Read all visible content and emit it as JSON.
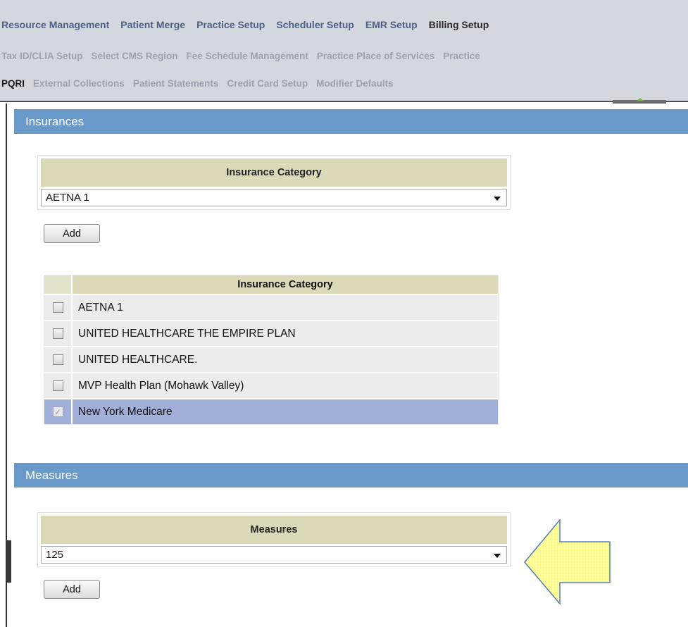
{
  "nav": {
    "main": [
      "Resource Management",
      "Patient Merge",
      "Practice Setup",
      "Scheduler Setup",
      "EMR Setup",
      "Billing Setup"
    ],
    "active_main": "Billing Setup",
    "sub_row1": [
      "Tax ID/CLIA Setup",
      "Select CMS Region",
      "Fee Schedule Management",
      "Practice Place of Services",
      "Practice"
    ],
    "sub_row2": [
      "PQRI",
      "External Collections",
      "Patient Statements",
      "Credit Card Setup",
      "Modifier Defaults"
    ],
    "active_sub": "PQRI"
  },
  "insurances": {
    "section_title": "Insurances",
    "panel_header": "Insurance Category",
    "selected_value": "AETNA 1",
    "add_label": "Add",
    "list_header": "Insurance Category",
    "items": [
      {
        "label": "AETNA 1",
        "checked": false,
        "selected": false
      },
      {
        "label": "UNITED HEALTHCARE THE EMPIRE PLAN",
        "checked": false,
        "selected": false
      },
      {
        "label": "UNITED HEALTHCARE.",
        "checked": false,
        "selected": false
      },
      {
        "label": "MVP Health Plan (Mohawk Valley)",
        "checked": false,
        "selected": false
      },
      {
        "label": "New York Medicare",
        "checked": true,
        "selected": true
      }
    ]
  },
  "measures": {
    "section_title": "Measures",
    "panel_header": "Measures",
    "selected_value": "125",
    "add_label": "Add"
  },
  "colors": {
    "section_header": "#6999c9",
    "nav_band": "#d3d8de",
    "panel_header": "#dcd9b8",
    "selected_row": "#a2afd9",
    "arrow_fill": "#ffff99",
    "arrow_stroke": "#5a82b4"
  },
  "icons": {
    "dropdown": "chevron-down-icon",
    "annotation": "left-arrow-callout-icon"
  }
}
